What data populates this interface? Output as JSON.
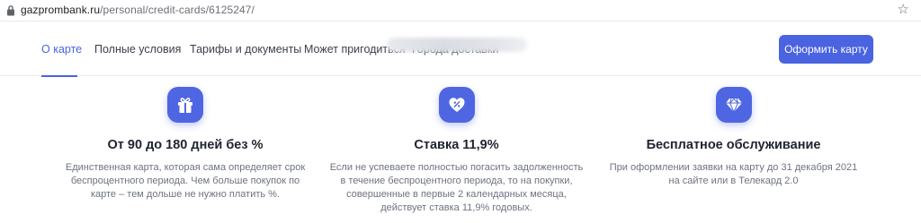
{
  "browser": {
    "url_domain": "gazprombank.ru",
    "url_path": "/personal/credit-cards/6125247/"
  },
  "nav": {
    "tabs": [
      {
        "label": "О карте",
        "active": true
      },
      {
        "label": "Полные условия"
      },
      {
        "label": "Тарифы и документы"
      },
      {
        "label": "Может пригодиться"
      },
      {
        "label": "Города доставки"
      }
    ],
    "cta_label": "Оформить карту"
  },
  "features": [
    {
      "icon": "gift-icon",
      "title": "От 90 до 180 дней без %",
      "lines": [
        "Единственная карта, которая сама определяет срок",
        "беспроцентного периода. Чем больше покупок по",
        "карте – тем дольше не нужно платить %."
      ]
    },
    {
      "icon": "heart-percent-icon",
      "title": "Ставка 11,9%",
      "lines": [
        "Если не успеваете полностью погасить задолженность",
        "в течение беспроцентного периода, то на покупки,",
        "совершенные в первые 2 календарных месяца,",
        "действует ставка 11,9% годовых."
      ]
    },
    {
      "icon": "diamond-icon",
      "title": "Бесплатное обслуживание",
      "lines": [
        "При оформлении заявки на карту до 31 декабря 2021",
        "на сайте или в Телекард 2.0"
      ]
    }
  ],
  "colors": {
    "accent": "#4a63e0",
    "icon_bg": "#4f66e3"
  }
}
